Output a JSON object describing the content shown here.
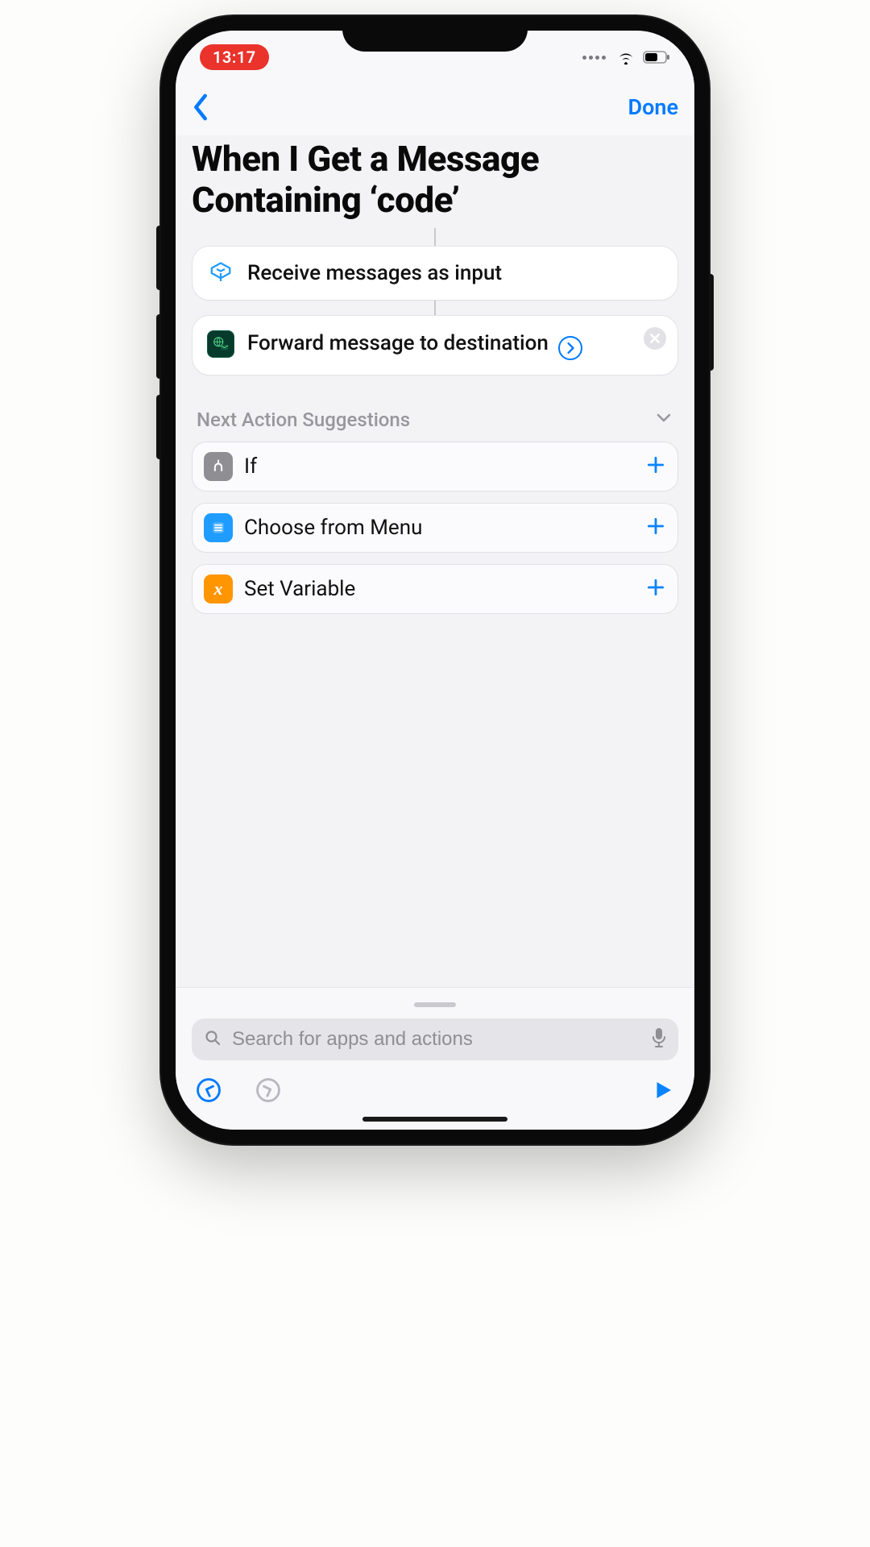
{
  "status": {
    "time": "13:17"
  },
  "nav": {
    "done": "Done"
  },
  "title": "When I Get a Message Containing ‘code’",
  "actions": {
    "input": {
      "label": "Receive messages as input"
    },
    "forward": {
      "label": "Forward message to destination"
    }
  },
  "suggestions": {
    "header": "Next Action Suggestions",
    "items": [
      {
        "label": "If"
      },
      {
        "label": "Choose from Menu"
      },
      {
        "label": "Set Variable"
      }
    ]
  },
  "search": {
    "placeholder": "Search for apps and actions"
  }
}
